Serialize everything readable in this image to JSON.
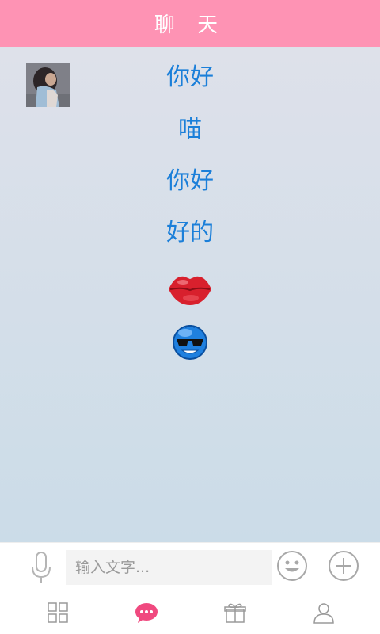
{
  "header": {
    "title": "聊 天"
  },
  "messages": [
    {
      "type": "text",
      "text": "你好"
    },
    {
      "type": "text",
      "text": "喵"
    },
    {
      "type": "text",
      "text": "你好"
    },
    {
      "type": "text",
      "text": "好的"
    },
    {
      "type": "emoji",
      "icon": "kiss-lips-icon"
    },
    {
      "type": "emoji",
      "icon": "cool-face-icon"
    }
  ],
  "input": {
    "placeholder": "输入文字...",
    "value": ""
  },
  "colors": {
    "header": "#fe93b4",
    "message_text": "#1b7fd9",
    "tab_active": "#f0497f",
    "tab_inactive": "#9a9a9a"
  },
  "tabs": [
    {
      "icon": "grid-icon",
      "active": false
    },
    {
      "icon": "chat-bubble-icon",
      "active": true
    },
    {
      "icon": "gift-icon",
      "active": false
    },
    {
      "icon": "user-icon",
      "active": false
    }
  ]
}
